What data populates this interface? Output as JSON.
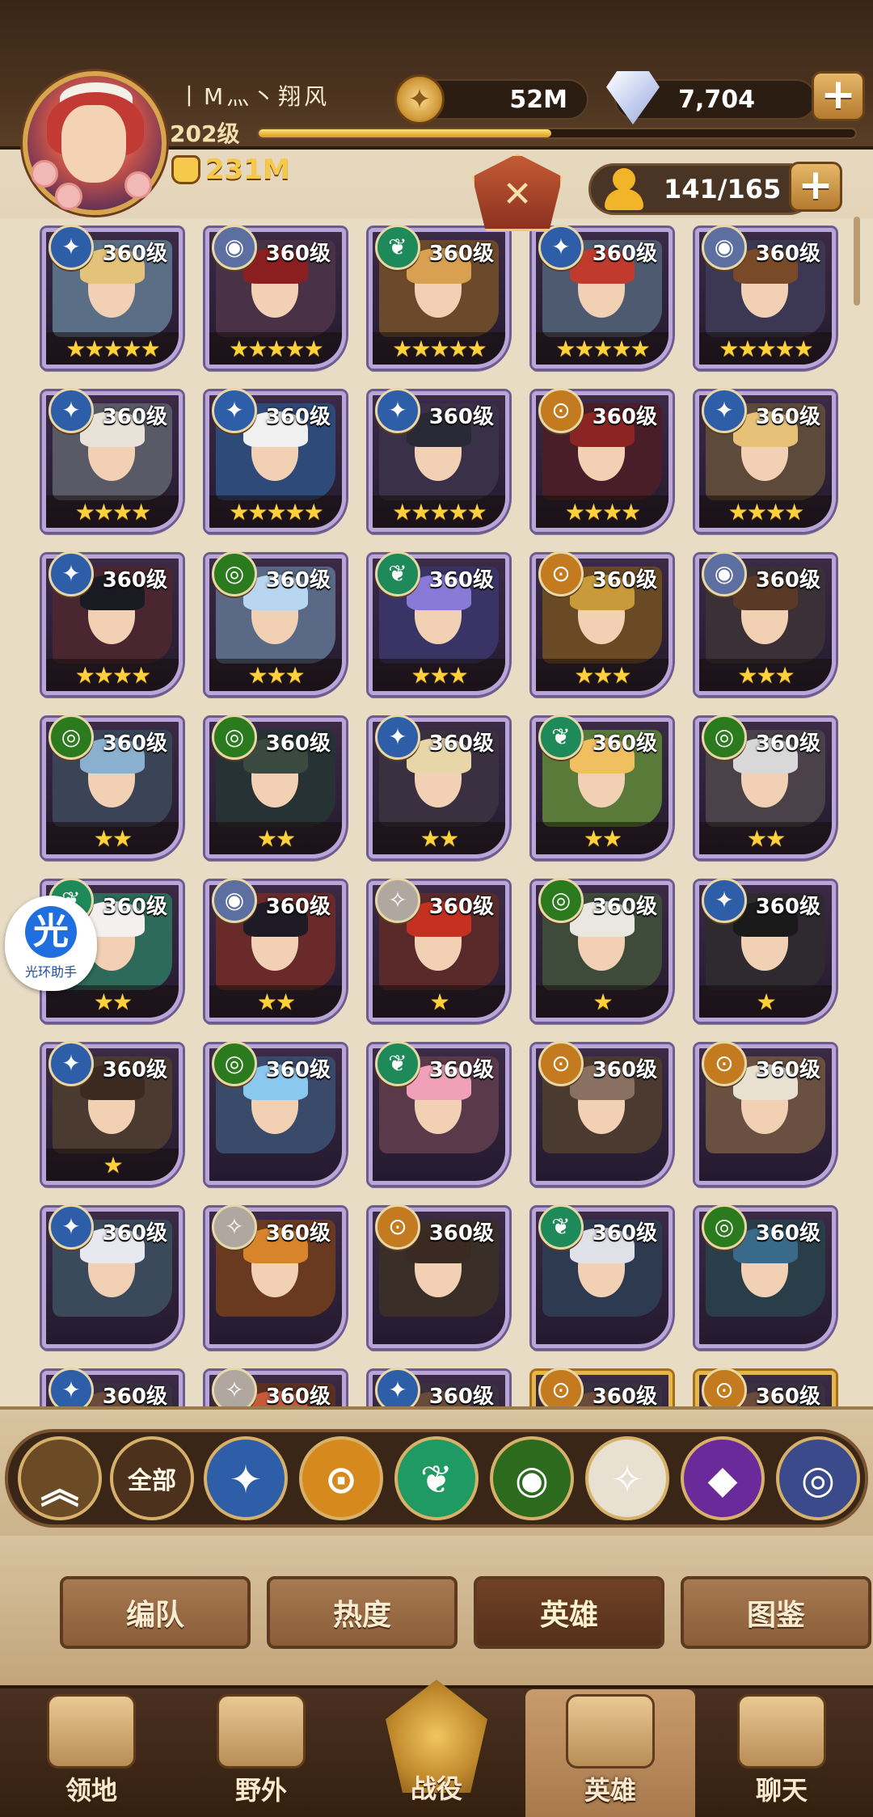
{
  "player": {
    "name": "丨M灬丶翔风",
    "level": "202级",
    "xp_fraction": 0.49,
    "power": "231M"
  },
  "resources": {
    "gold": "52M",
    "gems": "7,704"
  },
  "hero_count": "141/165",
  "cards": [
    {
      "level": "360级",
      "stars": "★★★★★",
      "faction": "lightbearer",
      "glyph": "✦",
      "color": "#2f5ea8",
      "hair": "#e3c27a",
      "art": "#5a6f86"
    },
    {
      "level": "360级",
      "stars": "★★★★★",
      "faction": "celestial",
      "glyph": "◉",
      "color": "#5d6fa0",
      "hair": "#8b1f1f",
      "art": "#4a3246"
    },
    {
      "level": "360级",
      "stars": "★★★★★",
      "faction": "wilder",
      "glyph": "❦",
      "color": "#1e8a5a",
      "hair": "#d8a050",
      "art": "#6a4a2a"
    },
    {
      "level": "360级",
      "stars": "★★★★★",
      "faction": "lightbearer",
      "glyph": "✦",
      "color": "#2f5ea8",
      "hair": "#c23a2d",
      "art": "#4e5a70"
    },
    {
      "level": "360级",
      "stars": "★★★★★",
      "faction": "celestial",
      "glyph": "◉",
      "color": "#5d6fa0",
      "hair": "#7a4a28",
      "art": "#3c3854"
    },
    {
      "level": "360级",
      "stars": "★★★★",
      "faction": "lightbearer",
      "glyph": "✦",
      "color": "#2f5ea8",
      "hair": "#e8e2d8",
      "art": "#5a5a66"
    },
    {
      "level": "360级",
      "stars": "★★★★★",
      "faction": "lightbearer",
      "glyph": "✦",
      "color": "#2f5ea8",
      "hair": "#f0f0f0",
      "art": "#2e4a78"
    },
    {
      "level": "360级",
      "stars": "★★★★★",
      "faction": "lightbearer",
      "glyph": "✦",
      "color": "#2f5ea8",
      "hair": "#2a2a36",
      "art": "#3a3048"
    },
    {
      "level": "360级",
      "stars": "★★★★",
      "faction": "mauler",
      "glyph": "⊙",
      "color": "#c47a1e",
      "hair": "#8c2424",
      "art": "#4a1e28"
    },
    {
      "level": "360级",
      "stars": "★★★★",
      "faction": "lightbearer",
      "glyph": "✦",
      "color": "#2f5ea8",
      "hair": "#e7c178",
      "art": "#5e4a3a"
    },
    {
      "level": "360级",
      "stars": "★★★★",
      "faction": "lightbearer",
      "glyph": "✦",
      "color": "#2f5ea8",
      "hair": "#1a1a22",
      "art": "#4a2630"
    },
    {
      "level": "360级",
      "stars": "★★★",
      "faction": "graveborn",
      "glyph": "◎",
      "color": "#2c7a1e",
      "hair": "#b8d6f0",
      "art": "#5a6a86"
    },
    {
      "level": "360级",
      "stars": "★★★",
      "faction": "wilder",
      "glyph": "❦",
      "color": "#1e8a5a",
      "hair": "#8a7ad8",
      "art": "#3a3466"
    },
    {
      "level": "360级",
      "stars": "★★★",
      "faction": "mauler",
      "glyph": "⊙",
      "color": "#c47a1e",
      "hair": "#c89a3a",
      "art": "#6a4a24"
    },
    {
      "level": "360级",
      "stars": "★★★",
      "faction": "celestial",
      "glyph": "◉",
      "color": "#5d6fa0",
      "hair": "#5a3a26",
      "art": "#3a3036"
    },
    {
      "level": "360级",
      "stars": "★★",
      "faction": "graveborn",
      "glyph": "◎",
      "color": "#2c7a1e",
      "hair": "#8ab0d0",
      "art": "#3a4456"
    },
    {
      "level": "360级",
      "stars": "★★",
      "faction": "graveborn",
      "glyph": "◎",
      "color": "#2c7a1e",
      "hair": "#3a4a40",
      "art": "#263234"
    },
    {
      "level": "360级",
      "stars": "★★",
      "faction": "lightbearer",
      "glyph": "✦",
      "color": "#2f5ea8",
      "hair": "#e8d6a8",
      "art": "#3a3040"
    },
    {
      "level": "360级",
      "stars": "★★",
      "faction": "wilder",
      "glyph": "❦",
      "color": "#1e8a5a",
      "hair": "#f0c060",
      "art": "#5a7a3a"
    },
    {
      "level": "360级",
      "stars": "★★",
      "faction": "graveborn",
      "glyph": "◎",
      "color": "#2c7a1e",
      "hair": "#d8d8d8",
      "art": "#4a4248"
    },
    {
      "level": "360级",
      "stars": "★★",
      "faction": "wilder",
      "glyph": "❦",
      "color": "#1e8a5a",
      "hair": "#f4f0f0",
      "art": "#2e6a5a"
    },
    {
      "level": "360级",
      "stars": "★★",
      "faction": "celestial",
      "glyph": "◉",
      "color": "#5d6fa0",
      "hair": "#1e1a26",
      "art": "#6a2a2a"
    },
    {
      "level": "360级",
      "stars": "★",
      "faction": "hypogean",
      "glyph": "✧",
      "color": "#b0a8a0",
      "hair": "#c63020",
      "art": "#5a2a2a"
    },
    {
      "level": "360级",
      "stars": "★",
      "faction": "graveborn",
      "glyph": "◎",
      "color": "#2c7a1e",
      "hair": "#e8e8e0",
      "art": "#3e4a3a"
    },
    {
      "level": "360级",
      "stars": "★",
      "faction": "lightbearer",
      "glyph": "✦",
      "color": "#2f5ea8",
      "hair": "#1a1a1a",
      "art": "#2e2a30"
    },
    {
      "level": "360级",
      "stars": "★",
      "faction": "lightbearer",
      "glyph": "✦",
      "color": "#2f5ea8",
      "hair": "#3a2a20",
      "art": "#4a3a30"
    },
    {
      "level": "360级",
      "stars": "",
      "faction": "graveborn",
      "glyph": "◎",
      "color": "#2c7a1e",
      "hair": "#8ac8f0",
      "art": "#3a4a6a"
    },
    {
      "level": "360级",
      "stars": "",
      "faction": "wilder",
      "glyph": "❦",
      "color": "#1e8a5a",
      "hair": "#f0a0b8",
      "art": "#5a3a4a"
    },
    {
      "level": "360级",
      "stars": "",
      "faction": "mauler",
      "glyph": "⊙",
      "color": "#c47a1e",
      "hair": "#8a7060",
      "art": "#4a3a30"
    },
    {
      "level": "360级",
      "stars": "",
      "faction": "mauler",
      "glyph": "⊙",
      "color": "#c47a1e",
      "hair": "#e8e0d0",
      "art": "#6a5040"
    },
    {
      "level": "360级",
      "stars": "",
      "faction": "lightbearer",
      "glyph": "✦",
      "color": "#2f5ea8",
      "hair": "#e8e8f0",
      "art": "#3a4a5a"
    },
    {
      "level": "360级",
      "stars": "",
      "faction": "hypogean",
      "glyph": "✧",
      "color": "#b0a8a0",
      "hair": "#d8842a",
      "art": "#6a3a20"
    },
    {
      "level": "360级",
      "stars": "",
      "faction": "mauler",
      "glyph": "⊙",
      "color": "#c47a1e",
      "hair": "#3a2a22",
      "art": "#3a2e28"
    },
    {
      "level": "360级",
      "stars": "",
      "faction": "wilder",
      "glyph": "❦",
      "color": "#1e8a5a",
      "hair": "#e0e0e8",
      "art": "#2e3a50"
    },
    {
      "level": "360级",
      "stars": "",
      "faction": "graveborn",
      "glyph": "◎",
      "color": "#2c7a1e",
      "hair": "#3a6a8a",
      "art": "#2a3e4a"
    },
    {
      "level": "360级",
      "stars": "",
      "faction": "lightbearer",
      "glyph": "✦",
      "color": "#2f5ea8",
      "hair": "#6a4a3a",
      "art": "#3a3040",
      "gold": false
    },
    {
      "level": "360级",
      "stars": "",
      "faction": "hypogean",
      "glyph": "✧",
      "color": "#b0a8a0",
      "hair": "#c85a3a",
      "art": "#5a3020",
      "gold": false
    },
    {
      "level": "360级",
      "stars": "",
      "faction": "lightbearer",
      "glyph": "✦",
      "color": "#2f5ea8",
      "hair": "#6a4a3a",
      "art": "#3a3040",
      "gold": false
    },
    {
      "level": "360级",
      "stars": "",
      "faction": "mauler",
      "glyph": "⊙",
      "color": "#c47a1e",
      "hair": "#6a4a3a",
      "art": "#3a3040",
      "gold": true
    },
    {
      "level": "360级",
      "stars": "",
      "faction": "mauler",
      "glyph": "⊙",
      "color": "#c47a1e",
      "hair": "#6a4a3a",
      "art": "#3a3040",
      "gold": true
    }
  ],
  "filters": [
    {
      "name": "collapse",
      "glyph": "︽",
      "color": "#6b4a26"
    },
    {
      "name": "all",
      "label": "全部",
      "color": "#4c321c"
    },
    {
      "name": "lightbearer",
      "glyph": "✦",
      "color": "#2f5ea8"
    },
    {
      "name": "mauler",
      "glyph": "⊙",
      "color": "#d68a1e"
    },
    {
      "name": "wilder",
      "glyph": "❦",
      "color": "#1e9a62"
    },
    {
      "name": "graveborn",
      "glyph": "◉",
      "color": "#2c6a1e"
    },
    {
      "name": "celestial",
      "glyph": "✧",
      "color": "#e8e0d0"
    },
    {
      "name": "hypogean",
      "glyph": "◆",
      "color": "#6a2a9a"
    },
    {
      "name": "dimensional",
      "glyph": "◎",
      "color": "#3a4a8a"
    }
  ],
  "tabs": [
    "编队",
    "热度",
    "英雄",
    "图鉴"
  ],
  "active_tab": "英雄",
  "nav": [
    "领地",
    "野外",
    "战役",
    "英雄",
    "聊天"
  ],
  "active_nav": "英雄",
  "helper": {
    "glyph": "光",
    "label": "光环助手"
  }
}
